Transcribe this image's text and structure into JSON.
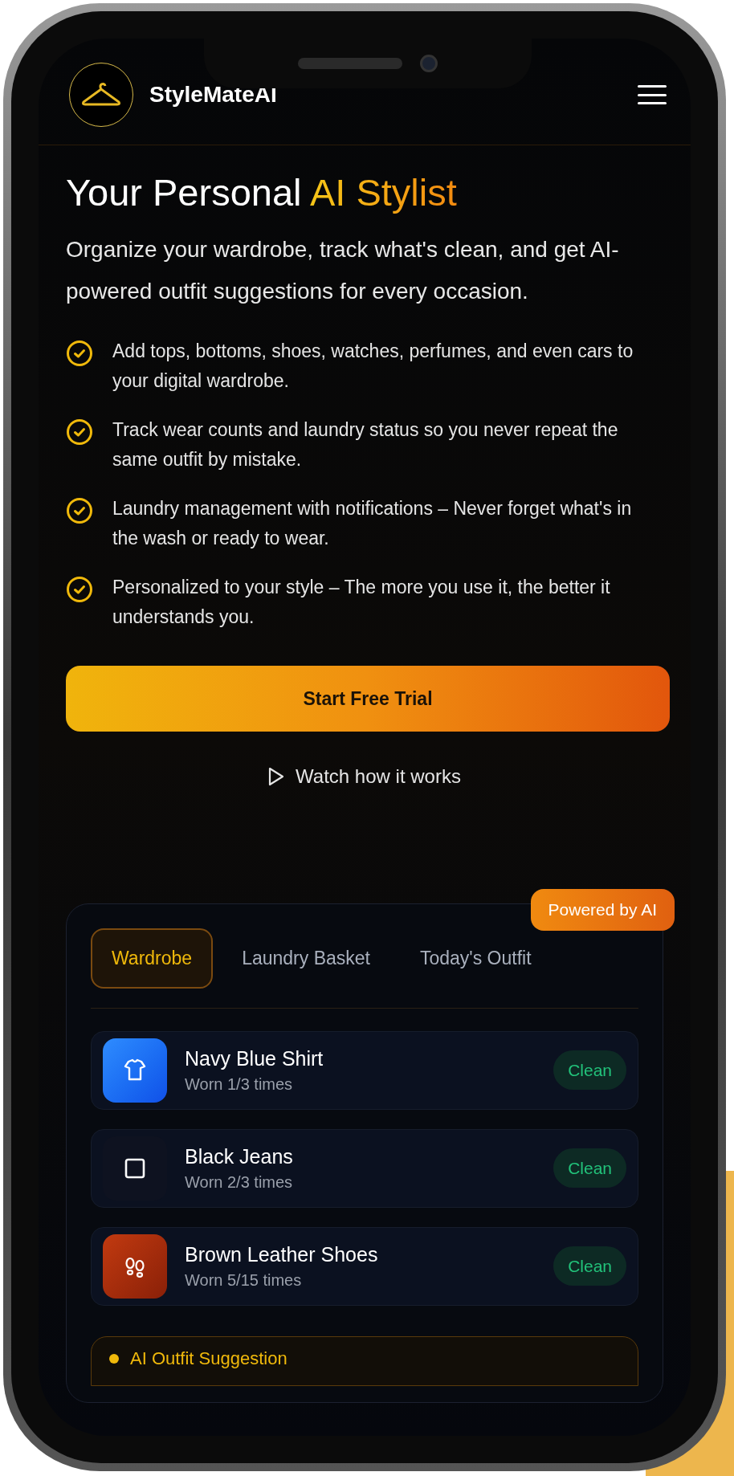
{
  "header": {
    "brand": "StyleMateAI"
  },
  "hero": {
    "title": "Your Personal",
    "title_highlight": "AI Stylist",
    "subtitle": "Organize your wardrobe, track what's clean, and get AI-powered outfit suggestions for every occasion."
  },
  "features": [
    "Add tops, bottoms, shoes, watches, perfumes, and even cars to your digital wardrobe.",
    "Track wear counts and laundry status so you never repeat the same outfit by mistake.",
    "Laundry management with notifications – Never forget what's in the wash or ready to wear.",
    "Personalized to your style – The more you use it, the better it understands you."
  ],
  "primary_button": "Start Free Trial",
  "secondary_link": "Watch how it works",
  "demo": {
    "badge": "Powered by AI",
    "tabs": [
      {
        "label": "Wardrobe",
        "selected": true
      },
      {
        "label": "Laundry Basket",
        "selected": false
      },
      {
        "label": "Today's Outfit",
        "selected": false
      }
    ],
    "items": [
      {
        "kind": "shirt",
        "name": "Navy Blue Shirt",
        "wear": "Worn 1/3 times",
        "status": "Clean"
      },
      {
        "kind": "square",
        "name": "Black Jeans",
        "wear": "Worn 2/3 times",
        "status": "Clean"
      },
      {
        "kind": "shoes",
        "name": "Brown Leather Shoes",
        "wear": "Worn 5/15 times",
        "status": "Clean"
      }
    ],
    "suggestion_title": "AI Outfit Suggestion"
  }
}
